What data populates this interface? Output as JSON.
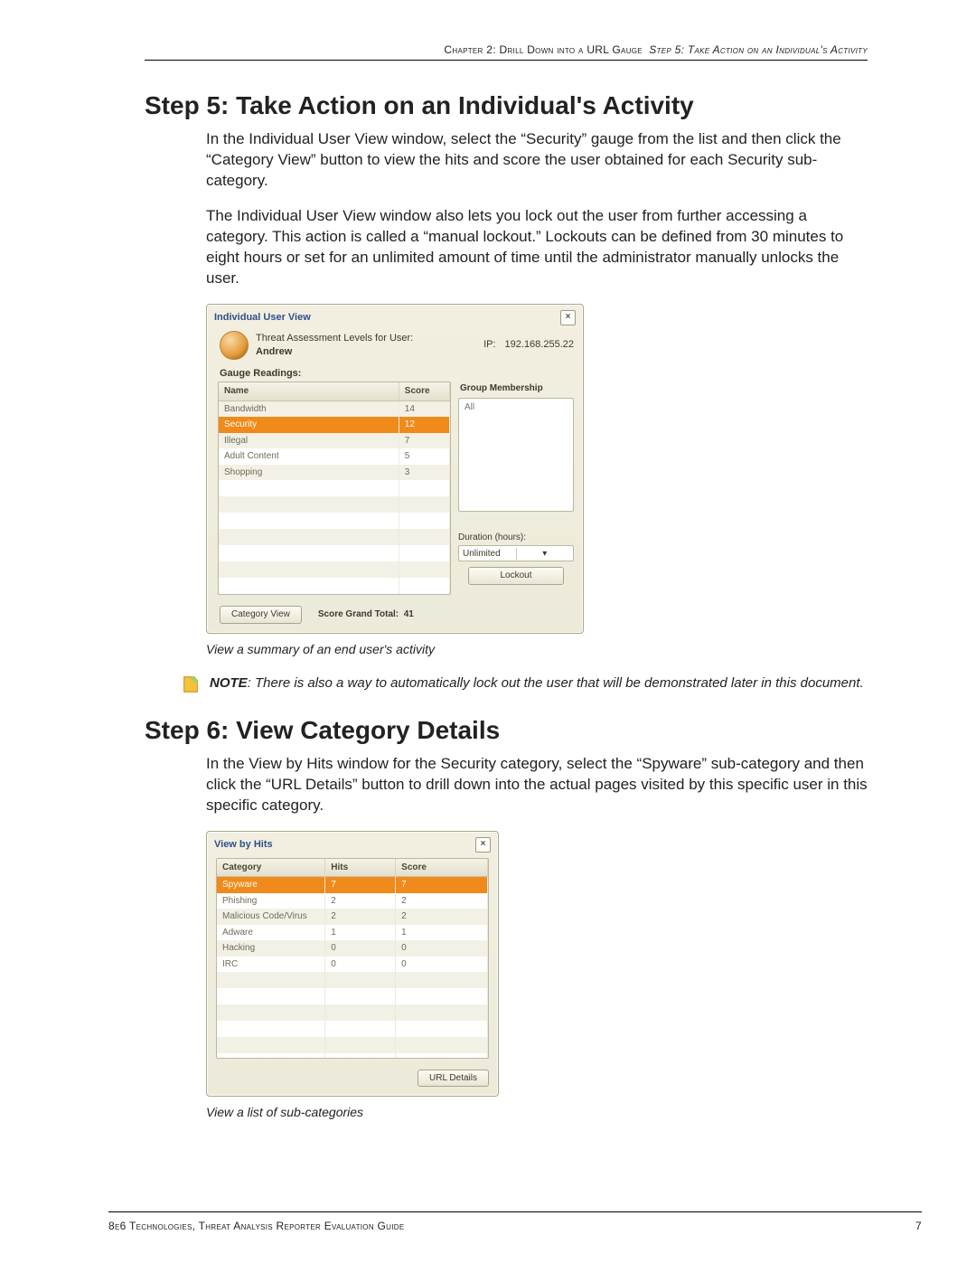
{
  "header": {
    "chapter": "Chapter 2: Drill Down into a URL Gauge",
    "step": "Step 5: Take Action on an Individual's Activity"
  },
  "step5": {
    "heading": "Step 5: Take Action on an Individual's Activity",
    "p1": "In the Individual User View window, select the “Security” gauge from the list and then click the “Category View” button to view the hits and score the user obtained for each Security sub-category.",
    "p2": "The Individual User View window also lets you lock out the user from further accessing a category. This action is called a “manual lockout.” Lockouts can be defined from 30 minutes to eight hours or set for an unlimited amount of time until the administrator manually unlocks the user.",
    "caption": "View a summary of an end user's activity",
    "note_label": "NOTE",
    "note": ": There is also a way to automatically lock out the user that will be demonstrated later in this document."
  },
  "iuv": {
    "title": "Individual User View",
    "assess_label": "Threat Assessment Levels for User:",
    "user": "Andrew",
    "ip_label": "IP:",
    "ip": "192.168.255.22",
    "gauge_label": "Gauge Readings:",
    "cols": {
      "name": "Name",
      "score": "Score"
    },
    "rows": [
      {
        "name": "Bandwidth",
        "score": "14",
        "sel": false
      },
      {
        "name": "Security",
        "score": "12",
        "sel": true
      },
      {
        "name": "Illegal",
        "score": "7",
        "sel": false
      },
      {
        "name": "Adult Content",
        "score": "5",
        "sel": false
      },
      {
        "name": "Shopping",
        "score": "3",
        "sel": false
      }
    ],
    "gm_title": "Group Membership",
    "gm_item": "All",
    "duration_label": "Duration (hours):",
    "duration_value": "Unlimited",
    "lockout_btn": "Lockout",
    "catview_btn": "Category View",
    "total_label": "Score Grand Total:",
    "total_value": "41"
  },
  "step6": {
    "heading": "Step 6: View Category Details",
    "p1": "In the View by Hits window for the Security category, select the “Spyware” sub-category and then click the “URL Details” button to drill down into the actual pages visited by this specific user in this specific category.",
    "caption": "View a list of sub-categories"
  },
  "vbh": {
    "title": "View by Hits",
    "cols": {
      "cat": "Category",
      "hits": "Hits",
      "score": "Score"
    },
    "rows": [
      {
        "cat": "Spyware",
        "hits": "7",
        "score": "7",
        "sel": true
      },
      {
        "cat": "Phishing",
        "hits": "2",
        "score": "2",
        "sel": false
      },
      {
        "cat": "Malicious Code/Virus",
        "hits": "2",
        "score": "2",
        "sel": false
      },
      {
        "cat": "Adware",
        "hits": "1",
        "score": "1",
        "sel": false
      },
      {
        "cat": "Hacking",
        "hits": "0",
        "score": "0",
        "sel": false
      },
      {
        "cat": "IRC",
        "hits": "0",
        "score": "0",
        "sel": false
      }
    ],
    "url_btn": "URL Details"
  },
  "footer": {
    "left": "8e6 Technologies, Threat Analysis Reporter Evaluation Guide",
    "page": "7"
  }
}
